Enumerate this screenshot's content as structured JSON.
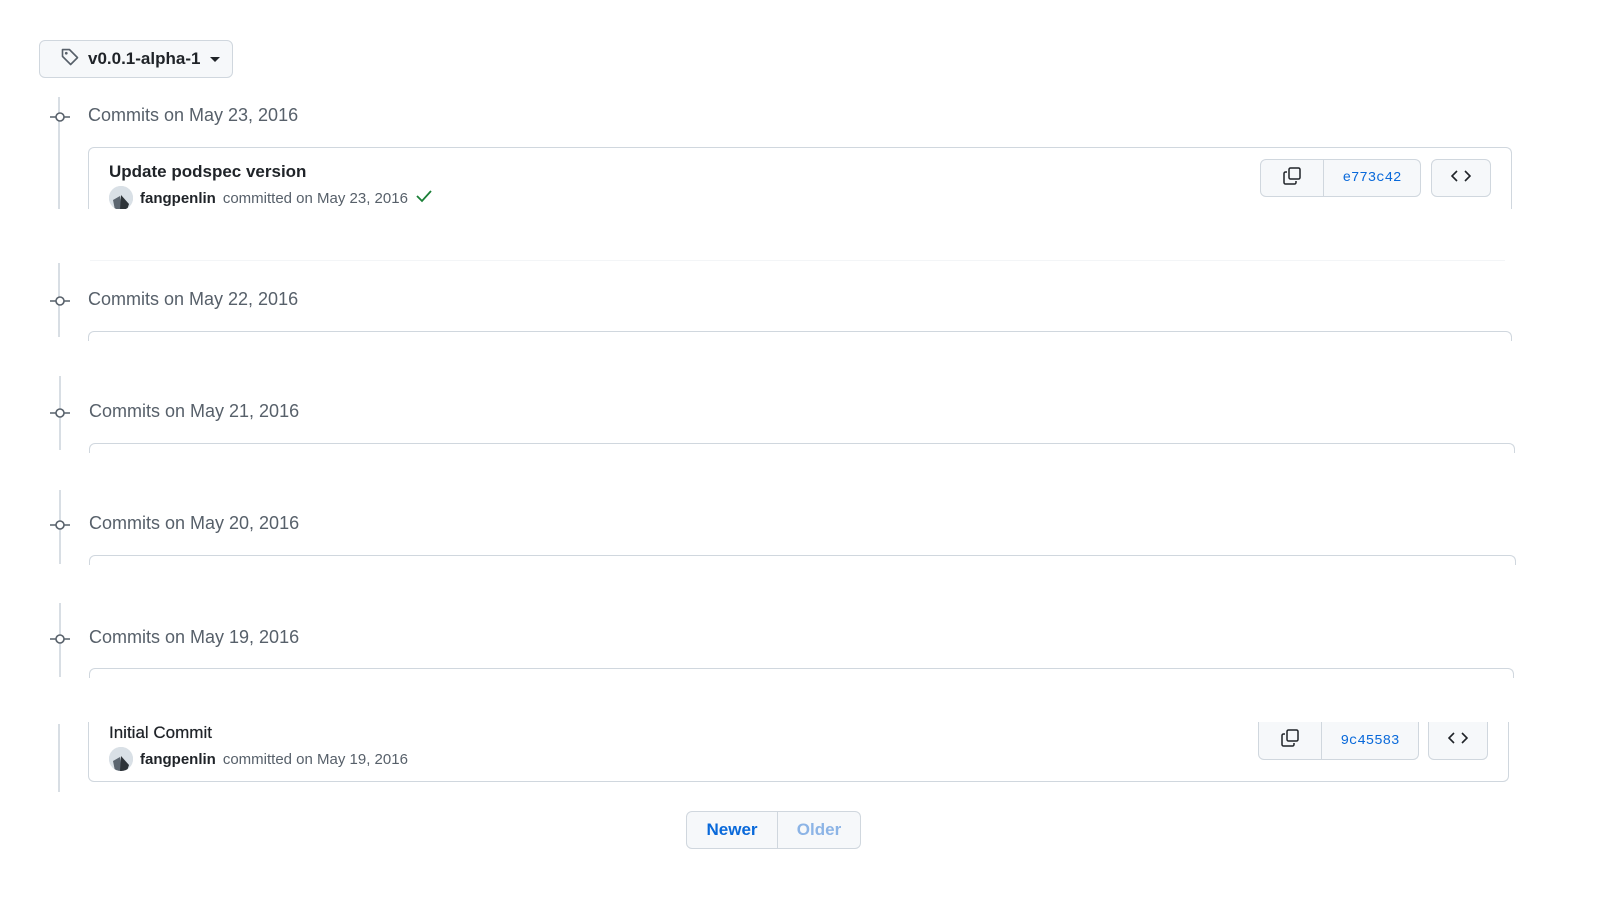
{
  "tag_selector": {
    "label": "v0.0.1-alpha-1"
  },
  "days": [
    {
      "heading": "Commits on May 23, 2016"
    },
    {
      "heading": "Commits on May 22, 2016"
    },
    {
      "heading": "Commits on May 21, 2016"
    },
    {
      "heading": "Commits on May 20, 2016"
    },
    {
      "heading": "Commits on May 19, 2016"
    }
  ],
  "commits": [
    {
      "title": "Update podspec version",
      "author": "fangpenlin",
      "committed_text": "committed on May 23, 2016",
      "sha": "e773c42",
      "status": "success"
    },
    {
      "title": "Initial Commit",
      "author": "fangpenlin",
      "committed_text": "committed on May 19, 2016",
      "sha": "9c45583"
    }
  ],
  "pagination": {
    "newer": "Newer",
    "older": "Older"
  },
  "colors": {
    "link": "#0969da",
    "muted": "#57606a",
    "success": "#1a7f37",
    "disabled_link": "#8cb4e6"
  }
}
